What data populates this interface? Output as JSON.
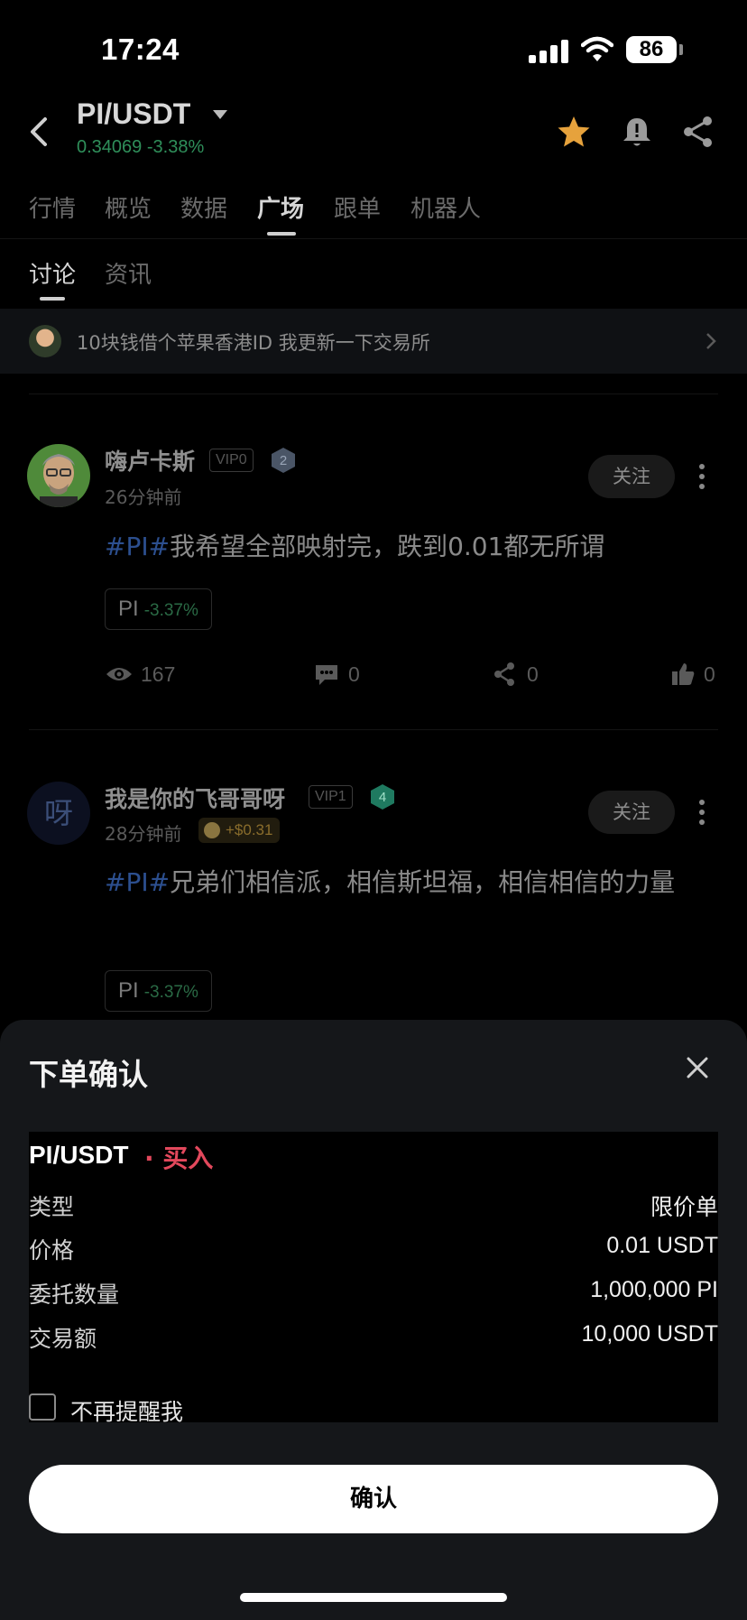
{
  "status_bar": {
    "time": "17:24",
    "battery": "86"
  },
  "header": {
    "pair": "PI/USDT",
    "price_line": "0.34069 -3.38%",
    "icons": [
      "back-icon",
      "star-icon",
      "bell-icon",
      "share-icon"
    ],
    "colors": {
      "star": "#e6a23c",
      "price_change": "#2f8f5a"
    }
  },
  "tabs": [
    "行情",
    "概览",
    "数据",
    "广场",
    "跟单",
    "机器人"
  ],
  "active_tab": "广场",
  "sub_tabs": [
    "讨论",
    "资讯"
  ],
  "active_sub_tab": "讨论",
  "banner": {
    "text": "10块钱借个苹果香港ID 我更新一下交易所"
  },
  "posts": [
    {
      "username": "嗨卢卡斯",
      "vip": "VIP0",
      "level": "2",
      "time": "26分钟前",
      "tag": "#PI#",
      "text": "我希望全部映射完，跌到0.01都无所谓",
      "coin": "PI",
      "coin_change": "-3.37%",
      "follow_label": "关注",
      "stats": {
        "views": "167",
        "comments": "0",
        "shares": "0",
        "likes": "0"
      }
    },
    {
      "username": "我是你的飞哥哥呀",
      "avatar_letter": "呀",
      "vip": "VIP1",
      "level": "4",
      "time": "28分钟前",
      "reward": "+$0.31",
      "tag": "#PI#",
      "text": "兄弟们相信派，相信斯坦福，相信相信的力量",
      "coin": "PI",
      "coin_change": "-3.37%",
      "follow_label": "关注"
    }
  ],
  "sheet": {
    "title": "下单确认",
    "pair": "PI/USDT",
    "side": "· 买入",
    "rows": [
      {
        "label": "类型",
        "value": "限价单"
      },
      {
        "label": "价格",
        "value": "0.01 USDT"
      },
      {
        "label": "委托数量",
        "value": "1,000,000 PI"
      },
      {
        "label": "交易额",
        "value": "10,000 USDT"
      }
    ],
    "dont_remind": "不再提醒我",
    "confirm": "确认",
    "colors": {
      "buy": "#e2485c"
    }
  }
}
